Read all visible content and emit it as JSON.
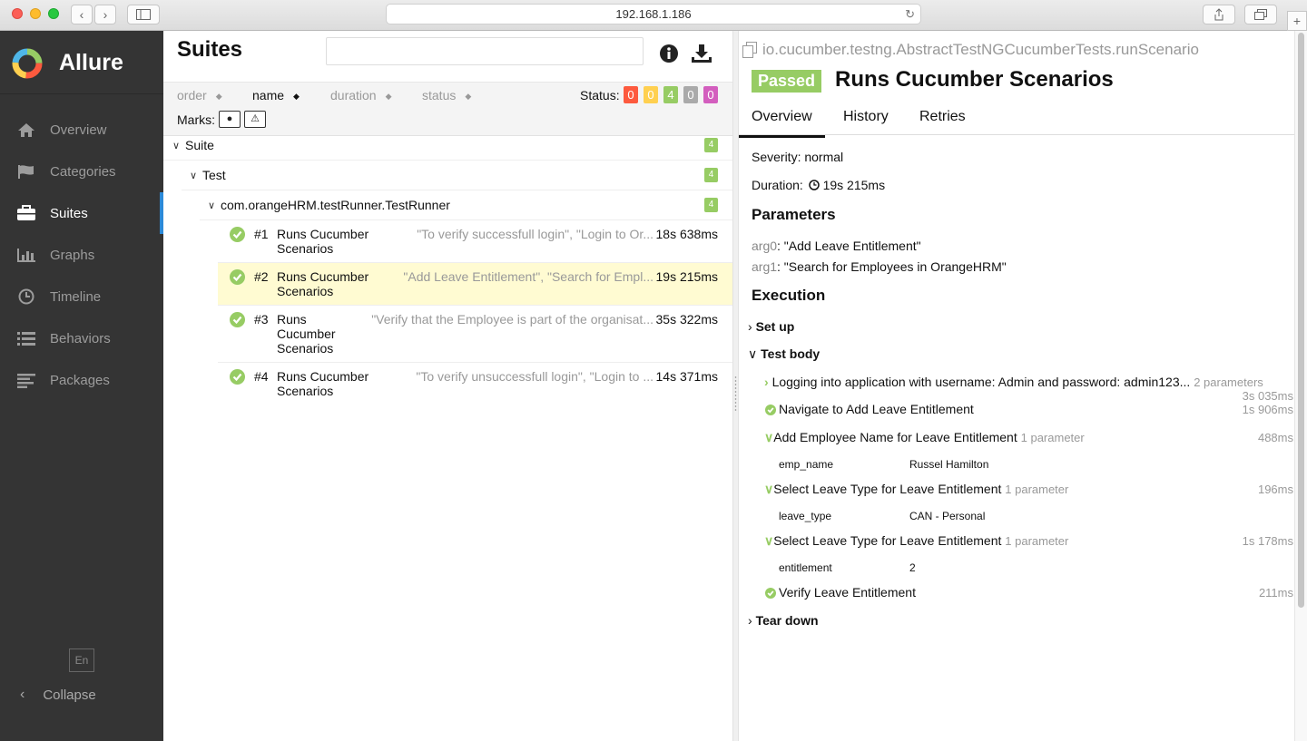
{
  "browser": {
    "address": "192.168.1.186"
  },
  "sidebar": {
    "brand": "Allure",
    "items": [
      {
        "label": "Overview",
        "icon": "home-icon"
      },
      {
        "label": "Categories",
        "icon": "flag-icon"
      },
      {
        "label": "Suites",
        "icon": "briefcase-icon",
        "active": true
      },
      {
        "label": "Graphs",
        "icon": "bar-chart-icon"
      },
      {
        "label": "Timeline",
        "icon": "clock-icon"
      },
      {
        "label": "Behaviors",
        "icon": "list-icon"
      },
      {
        "label": "Packages",
        "icon": "align-left-icon"
      }
    ],
    "language": "En",
    "collapse": "Collapse"
  },
  "suites": {
    "title": "Suites",
    "search_placeholder": "",
    "sort": {
      "order": "order",
      "name": "name",
      "duration": "duration",
      "status": "status"
    },
    "status_label": "Status:",
    "status_counts": [
      {
        "value": "0",
        "color": "#fd5a3e"
      },
      {
        "value": "0",
        "color": "#ffd050"
      },
      {
        "value": "4",
        "color": "#97cc64"
      },
      {
        "value": "0",
        "color": "#aaaaaa"
      },
      {
        "value": "0",
        "color": "#d35ebe"
      }
    ],
    "marks_label": "Marks:",
    "groups": [
      {
        "name": "Suite",
        "count": "4"
      },
      {
        "name": "Test",
        "count": "4"
      },
      {
        "name": "com.orangeHRM.testRunner.TestRunner",
        "count": "4"
      }
    ],
    "rows": [
      {
        "num": "#1",
        "name": "Runs Cucumber Scenarios",
        "params": "\"To verify successfull login\", \"Login to Or...",
        "duration": "18s 638ms"
      },
      {
        "num": "#2",
        "name": "Runs Cucumber Scenarios",
        "params": "\"Add Leave Entitlement\", \"Search for Empl...",
        "duration": "19s 215ms"
      },
      {
        "num": "#3",
        "name": "Runs Cucumber Scenarios",
        "params": "\"Verify that the Employee is part of the organisat...",
        "duration": "35s 322ms"
      },
      {
        "num": "#4",
        "name": "Runs Cucumber Scenarios",
        "params": "\"To verify unsuccessfull login\", \"Login to ...",
        "duration": "14s 371ms"
      }
    ]
  },
  "detail": {
    "fullname": "io.cucumber.testng.AbstractTestNGCucumberTests.runScenario",
    "status": "Passed",
    "title": "Runs Cucumber Scenarios",
    "tabs": [
      "Overview",
      "History",
      "Retries"
    ],
    "severity": "Severity: normal",
    "duration_label": "Duration:",
    "duration": "19s 215ms",
    "parameters_heading": "Parameters",
    "parameters": [
      {
        "key": "arg0",
        "value": ": \"Add Leave Entitlement\""
      },
      {
        "key": "arg1",
        "value": ": \"Search for Employees in OrangeHRM\""
      }
    ],
    "execution_heading": "Execution",
    "setup": "Set up",
    "test_body": "Test body",
    "teardown": "Tear down",
    "steps": [
      {
        "name": "Logging into application with username: Admin and password: admin123...",
        "note": "2 parameters",
        "duration": "3s 035ms"
      },
      {
        "name": "Navigate to Add Leave Entitlement",
        "note": "",
        "duration": "1s 906ms"
      },
      {
        "name": "Add Employee Name for Leave Entitlement",
        "note": "1 parameter",
        "duration": "488ms",
        "param_key": "emp_name",
        "param_value": "Russel Hamilton"
      },
      {
        "name": "Select Leave Type for Leave Entitlement",
        "note": "1 parameter",
        "duration": "196ms",
        "param_key": "leave_type",
        "param_value": "CAN - Personal"
      },
      {
        "name": "Select Leave Type for Leave Entitlement",
        "note": "1 parameter",
        "duration": "1s 178ms",
        "param_key": "entitlement",
        "param_value": "2"
      },
      {
        "name": "Verify Leave Entitlement",
        "note": "",
        "duration": "211ms"
      }
    ]
  }
}
